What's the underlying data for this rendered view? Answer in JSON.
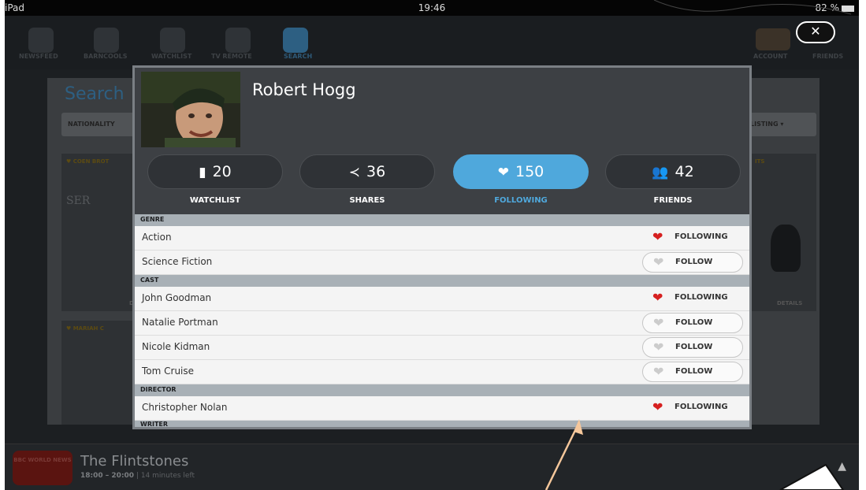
{
  "status_bar": {
    "device": "iPad",
    "time": "19:46",
    "battery": "82 %"
  },
  "background": {
    "nav_items": [
      "NEWSFEED",
      "BARNCOOLS",
      "WATCHLIST",
      "TV REMOTE",
      "SEARCH"
    ],
    "account_labels": [
      "ACCOUNT",
      "FRIENDS"
    ],
    "page_title": "Search",
    "filter_left": "NATIONALITY",
    "filter_right": "LISTING",
    "card_tags": [
      "COEN BROT",
      "MARIAH C",
      "ITS"
    ],
    "card_serif": "SER",
    "card_details": [
      "DET",
      "DETAILS"
    ],
    "now_playing": {
      "channel": "BBC WORLD NEWS",
      "title": "The Flintstones",
      "time": "18:00 – 20:00",
      "remaining": "14 minutes left"
    }
  },
  "profile": {
    "name": "Robert Hogg",
    "stats": [
      {
        "icon": "bookmark-icon",
        "value": "20",
        "label": "WATCHLIST"
      },
      {
        "icon": "share-icon",
        "value": "36",
        "label": "SHARES"
      },
      {
        "icon": "heart-icon",
        "value": "150",
        "label": "FOLLOWING"
      },
      {
        "icon": "people-icon",
        "value": "42",
        "label": "FRIENDS"
      }
    ]
  },
  "sections": {
    "genre": "GENRE",
    "cast": "CAST",
    "director": "DIRECTOR",
    "writer": "WRITER"
  },
  "rows": [
    {
      "name": "Action",
      "status": "FOLLOWING"
    },
    {
      "name": "Science Fiction",
      "status": "FOLLOW"
    },
    {
      "name": "John Goodman",
      "status": "FOLLOWING"
    },
    {
      "name": "Natalie Portman",
      "status": "FOLLOW"
    },
    {
      "name": "Nicole Kidman",
      "status": "FOLLOW"
    },
    {
      "name": "Tom Cruise",
      "status": "FOLLOW"
    },
    {
      "name": "Christopher Nolan",
      "status": "FOLLOWING"
    }
  ],
  "colors": {
    "accent": "#4fa8dc",
    "heart": "#d62020",
    "annotation_arrow": "#f5c79b"
  }
}
